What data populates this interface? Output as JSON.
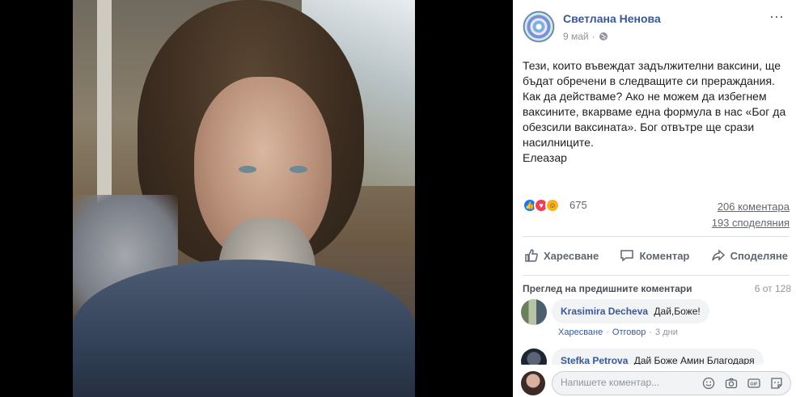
{
  "post": {
    "author": "Светлана Ненова",
    "date": "9 май",
    "separator": "·",
    "text_lines": [
      "Тези, които въвеждат задължителни ваксини, ще",
      "бъдат обречени в следващите си прераждания.",
      "Как да действаме? Ако не можем да избегнем",
      "ваксините, вкарваме една формула в нас «Бог да",
      "обезсили ваксината». Бог отвътре ще срази",
      "насилниците.",
      "Елеазар"
    ]
  },
  "stats": {
    "reactions_count": "675",
    "reaction_icons": [
      "like-icon",
      "love-icon",
      "haha-icon"
    ],
    "comments": "206 коментара",
    "shares": "193 споделяния"
  },
  "actions": {
    "like": "Харесване",
    "comment": "Коментар",
    "share": "Споделяне"
  },
  "comments_section": {
    "view_previous": "Преглед на предишните коментари",
    "counter": "6 от 128",
    "items": [
      {
        "author": "Krasimira Decheva",
        "text": "Дай,Боже!",
        "like": "Харесване",
        "reply": "Отговор",
        "dot": "·",
        "time": "3 дни"
      },
      {
        "author": "Stefka Petrova",
        "text": "Дай Боже Амин Благодаря"
      }
    ]
  },
  "composer": {
    "placeholder": "Напишете коментар..."
  },
  "colors": {
    "link": "#365899",
    "like_blue": "#1877f2",
    "love_red": "#f33e58",
    "haha_yellow": "#f7b125"
  }
}
